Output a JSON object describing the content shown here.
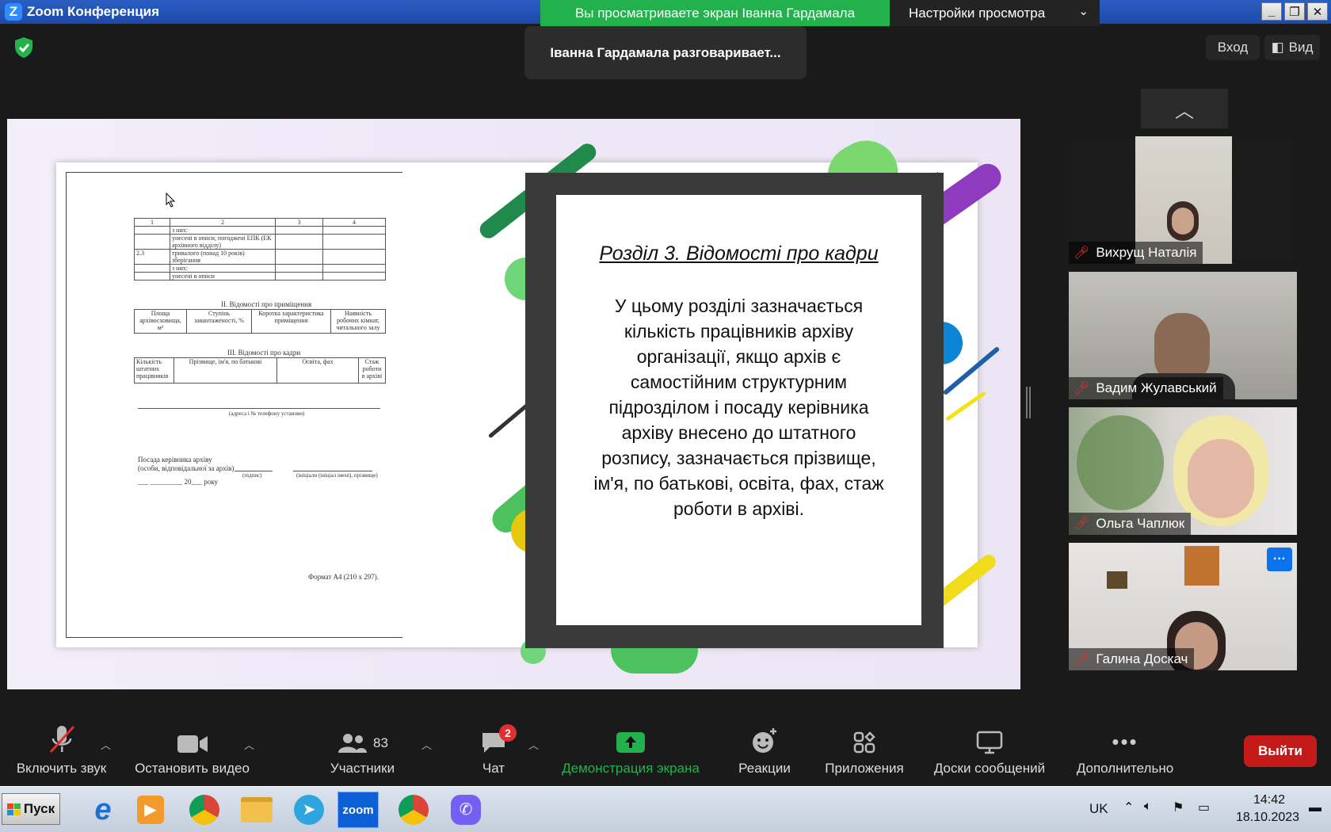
{
  "window": {
    "title": "Zoom Конференция",
    "logo": "Z",
    "controls": [
      "_",
      "❐",
      "✕"
    ]
  },
  "share_bar": {
    "viewing_label": "Вы просматриваете экран Іванна Гардамала",
    "view_options_label": "Настройки просмотра"
  },
  "speaking_toast": "Іванна Гардамала разговаривает...",
  "top_right": {
    "enter_label": "Вход",
    "view_label": "Вид"
  },
  "slide": {
    "title": "Розділ 3. Відомості про кадри",
    "body": "У цьому розділі зазначається кількість працівників архіву організації, якщо архів є самостійним структурним підрозділом і посаду керівника архіву внесено до штатного розпису, зазначається прізвище, ім'я, по батькові, освіта, фах, стаж роботи в архіві."
  },
  "scan": {
    "table1": {
      "header": [
        "1",
        "2",
        "3",
        "4"
      ],
      "rows": [
        [
          "",
          "з них:",
          "",
          ""
        ],
        [
          "",
          "унесені в описи, погоджені ЕПК (ЕК архівного відділу)",
          "",
          ""
        ],
        [
          "2.3",
          "тривалого (понад 10 років) зберігання",
          "",
          ""
        ],
        [
          "",
          "з них:",
          "",
          ""
        ],
        [
          "",
          "унесені в описи",
          "",
          ""
        ]
      ]
    },
    "section2_title": "ІІ. Відомості про приміщення",
    "table2": [
      "Площа архівосховища, м²",
      "Ступінь завантаженості, %",
      "Коротка характеристика приміщення",
      "Наявність робочих кімнат, читального залу"
    ],
    "section3_title": "ІІІ. Відомості про кадри",
    "table3": [
      "Кількість штатних працівників",
      "Прізвище, ім'я, по батькові",
      "Освіта, фах",
      "Стаж роботи в архіві"
    ],
    "address_caption": "(адреса і № телефону установи)",
    "head_label_1": "Посада керівника архіву",
    "head_label_2": "(особи, відповідальної за архів)",
    "sign_caption": "(підпис)",
    "name_caption": "(ініціали (ініціал імені), прізвище)",
    "date_line": "___ _________ 20___ року",
    "format": "Формат А4 (210 х 297)."
  },
  "participants": [
    {
      "name": "Вихрущ Наталія",
      "muted": true
    },
    {
      "name": "Вадим Жулавський",
      "muted": true
    },
    {
      "name": "Ольга Чаплюк",
      "muted": true
    },
    {
      "name": "Галина Доскач",
      "muted": true
    }
  ],
  "toolbar": {
    "unmute": "Включить звук",
    "stop_video": "Остановить видео",
    "participants": "Участники",
    "participants_count": "83",
    "chat": "Чат",
    "chat_badge": "2",
    "share_screen": "Демонстрация экрана",
    "reactions": "Реакции",
    "apps": "Приложения",
    "whiteboards": "Доски сообщений",
    "more": "Дополнительно",
    "leave": "Выйти"
  },
  "taskbar": {
    "start": "Пуск",
    "zoom_label": "zoom",
    "lang": "UK",
    "time": "14:42",
    "date": "18.10.2023"
  },
  "colors": {
    "share_green": "#22b14c",
    "leave_red": "#c41a1a",
    "accent_blue": "#0e72ed"
  }
}
